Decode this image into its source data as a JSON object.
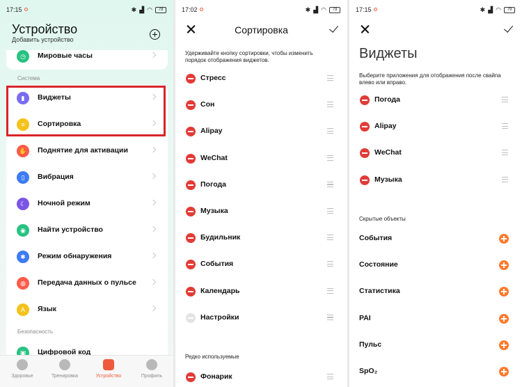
{
  "screen1": {
    "status_time": "17:15",
    "battery": "79",
    "title": "Устройство",
    "subtitle": "Добавить устройство",
    "top_item": "Мировые часы",
    "section_system": "Система",
    "system_items": [
      {
        "label": "Виджеты",
        "color": "#7a6cf0",
        "glyph": "▮"
      },
      {
        "label": "Сортировка",
        "color": "#f4c21c",
        "glyph": "≡"
      }
    ],
    "items": [
      {
        "label": "Поднятие для активации",
        "color": "#ff5a4a",
        "glyph": "✋"
      },
      {
        "label": "Вибрация",
        "color": "#3d7bf4",
        "glyph": "▯"
      },
      {
        "label": "Ночной режим",
        "color": "#7a55e6",
        "glyph": "☾"
      },
      {
        "label": "Найти устройство",
        "color": "#27c281",
        "glyph": "◉"
      },
      {
        "label": "Режим обнаружения",
        "color": "#3d7bf4",
        "glyph": "✱"
      },
      {
        "label": "Передача данных о пульсе",
        "color": "#ff5a4a",
        "glyph": "◍"
      },
      {
        "label": "Язык",
        "color": "#f4c21c",
        "glyph": "A"
      }
    ],
    "section_security": "Безопасность",
    "security_item": "Цифровой код",
    "tabs": [
      "Здоровье",
      "Тренировка",
      "Устройство",
      "Профиль"
    ]
  },
  "screen2": {
    "status_time": "17:02",
    "battery": "79",
    "title": "Сортировка",
    "hint": "Удерживайте кнопку сортировки, чтобы изменить порядок отображения виджетов.",
    "items": [
      "Стресс",
      "Сон",
      "Alipay",
      "WeChat",
      "Погода",
      "Музыка",
      "Будильник",
      "События",
      "Календарь",
      "Настройки"
    ],
    "section_rare": "Редко используемые",
    "rare_items": [
      "Фонарик"
    ]
  },
  "screen3": {
    "status_time": "17:15",
    "battery": "79",
    "title": "Виджеты",
    "hint": "Выберите приложения для отображения после свайпа влево или вправо.",
    "items": [
      "Погода",
      "Alipay",
      "WeChat",
      "Музыка"
    ],
    "section_hidden": "Скрытые объекты",
    "hidden_items": [
      "События",
      "Состояние",
      "Статистика",
      "PAI",
      "Пульс",
      "SpO₂"
    ]
  }
}
